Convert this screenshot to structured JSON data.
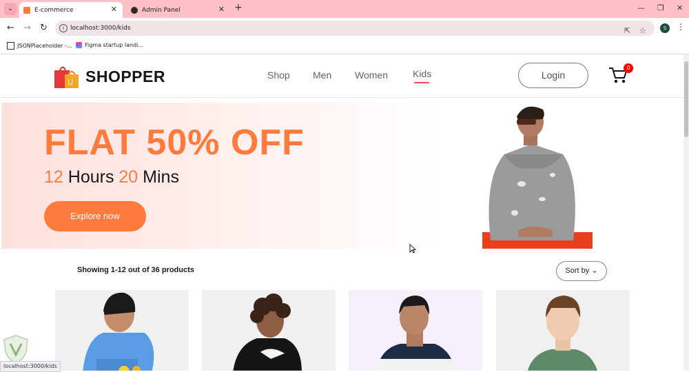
{
  "browser": {
    "tabs": [
      {
        "title": "E-commerce",
        "active": true
      },
      {
        "title": "Admin Panel",
        "active": false
      }
    ],
    "new_tab_icon": "plus-icon",
    "url": "localhost:3000/kids",
    "profile_initial": "S",
    "bookmarks": [
      {
        "label": "JSONPlaceholder -..."
      },
      {
        "label": "Figma startup landi..."
      }
    ],
    "status_url": "localhost:3000/kids"
  },
  "navbar": {
    "brand": "SHOPPER",
    "menu": [
      "Shop",
      "Men",
      "Women",
      "Kids"
    ],
    "active_menu": "Kids",
    "login_label": "Login",
    "cart_count": "0"
  },
  "hero": {
    "title": "FLAT 50% OFF",
    "hours_num": "12",
    "hours_label": "Hours",
    "mins_num": "20",
    "mins_label": "Mins",
    "cta": "Explore now"
  },
  "listing": {
    "showing_text": "Showing 1-12 out of 36 products",
    "sort_label": "Sort by"
  },
  "colors": {
    "accent": "#ff7a3d",
    "brand_red": "#ff4141",
    "tab_bar": "#ffc1c6"
  }
}
